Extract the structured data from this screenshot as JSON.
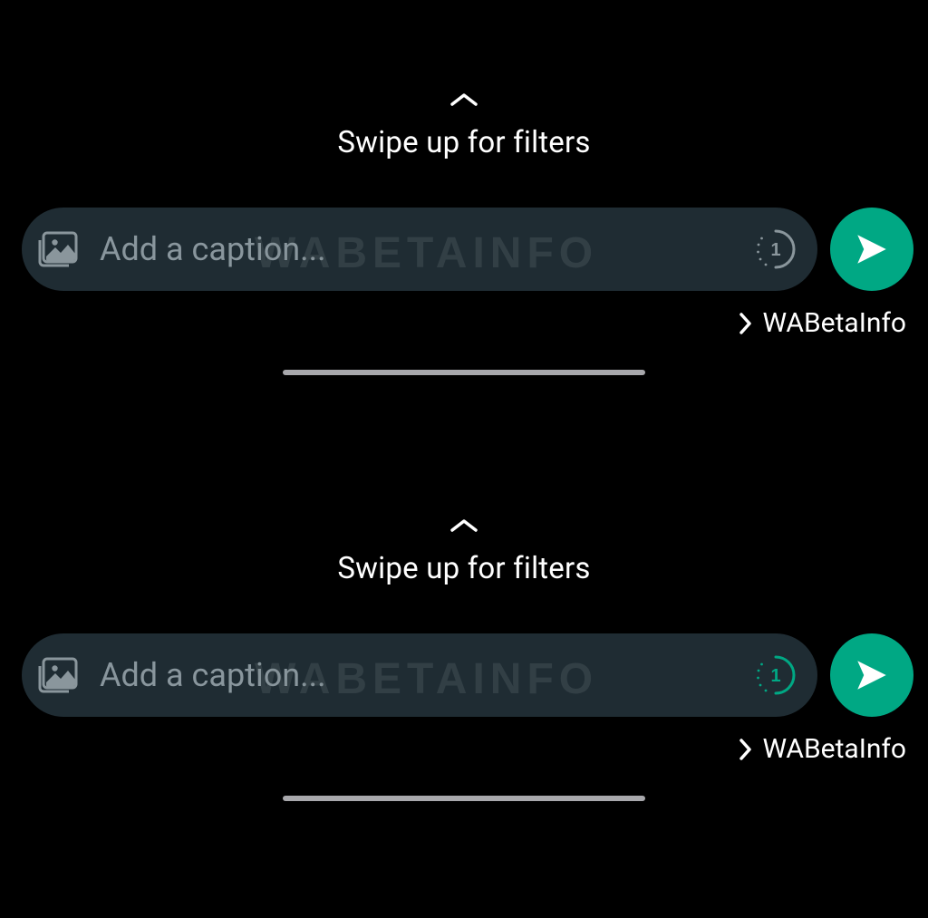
{
  "top": {
    "swipe_hint": "Swipe up for filters",
    "caption_placeholder": "Add a caption...",
    "watermark_text": "WABETAINFO",
    "view_once_number": "1",
    "view_once_state": "inactive",
    "recipient_label": "WABetaInfo"
  },
  "bottom": {
    "swipe_hint": "Swipe up for filters",
    "caption_placeholder": "Add a caption...",
    "watermark_text": "WABETAINFO",
    "view_once_number": "1",
    "view_once_state": "active",
    "recipient_label": "WABetaInfo"
  },
  "colors": {
    "accent": "#00a884",
    "pill_bg": "#1f2c33",
    "muted": "#8a969c"
  }
}
